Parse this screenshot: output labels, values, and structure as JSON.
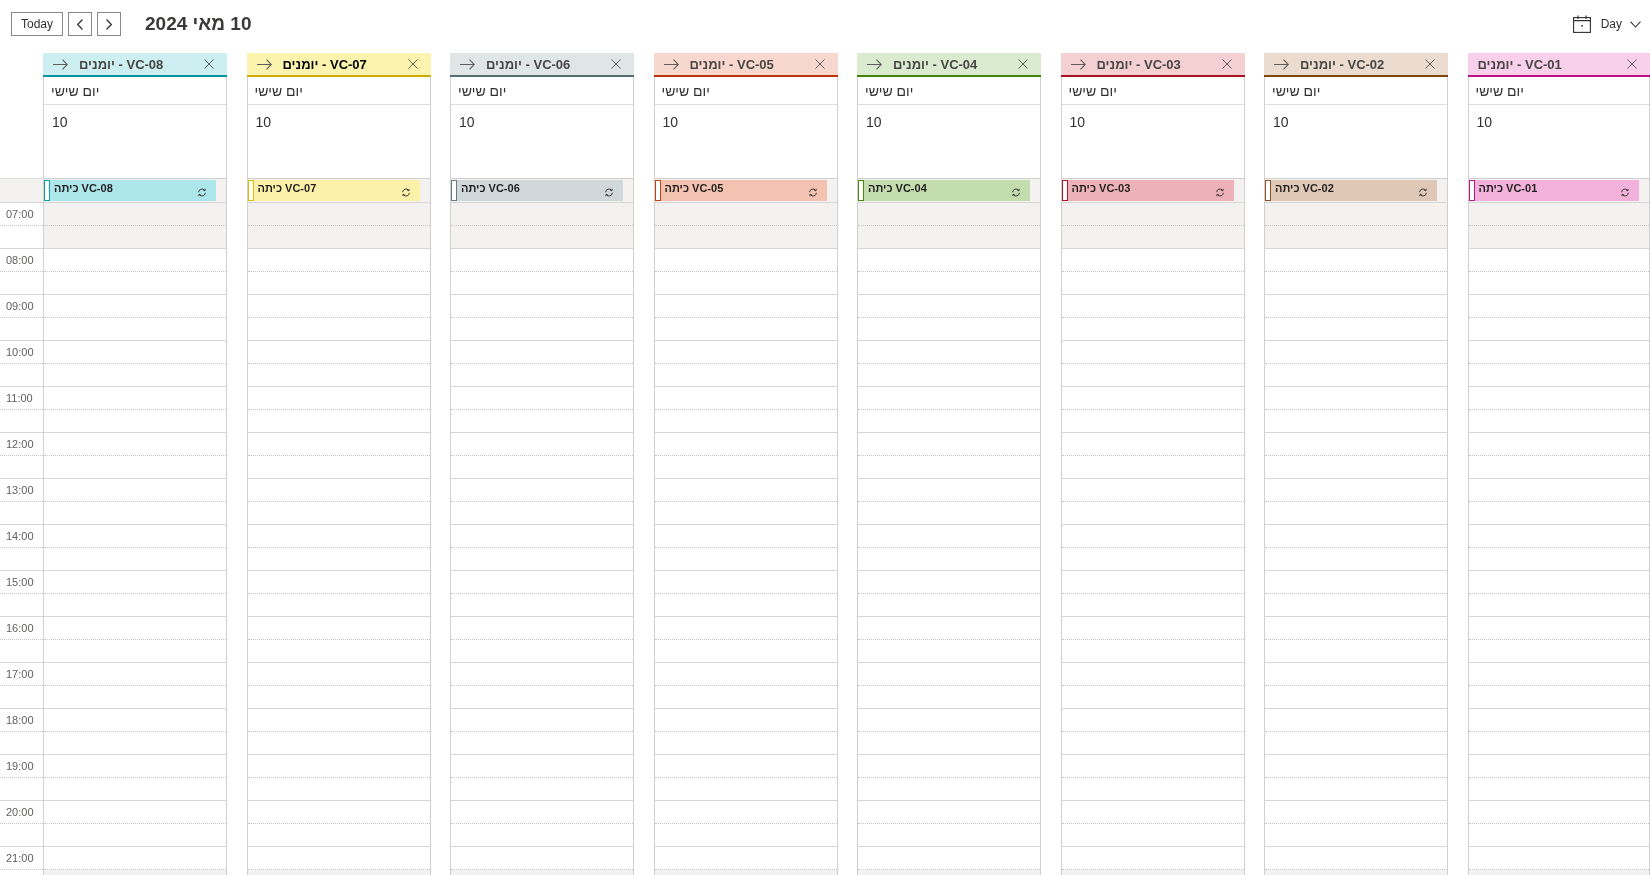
{
  "toolbar": {
    "today_button": "Today",
    "date_title": "10 מאי 2024",
    "view": "Day"
  },
  "hours": [
    {
      "label": "07:00",
      "slots": [
        {
          "off_hours": true
        },
        {
          "off_hours": true
        }
      ]
    },
    {
      "label": "08:00",
      "slots": [
        {
          "off_hours": false
        },
        {
          "off_hours": false
        }
      ]
    },
    {
      "label": "09:00",
      "slots": [
        {
          "off_hours": false
        },
        {
          "off_hours": false
        }
      ]
    },
    {
      "label": "10:00",
      "slots": [
        {
          "off_hours": false
        },
        {
          "off_hours": false
        }
      ]
    },
    {
      "label": "11:00",
      "slots": [
        {
          "off_hours": false
        },
        {
          "off_hours": false
        }
      ]
    },
    {
      "label": "12:00",
      "slots": [
        {
          "off_hours": false
        },
        {
          "off_hours": false
        }
      ]
    },
    {
      "label": "13:00",
      "slots": [
        {
          "off_hours": false
        },
        {
          "off_hours": false
        }
      ]
    },
    {
      "label": "14:00",
      "slots": [
        {
          "off_hours": false
        },
        {
          "off_hours": false
        }
      ]
    },
    {
      "label": "15:00",
      "slots": [
        {
          "off_hours": false
        },
        {
          "off_hours": false
        }
      ]
    },
    {
      "label": "16:00",
      "slots": [
        {
          "off_hours": false
        },
        {
          "off_hours": false
        }
      ]
    },
    {
      "label": "17:00",
      "slots": [
        {
          "off_hours": false
        },
        {
          "off_hours": false
        }
      ]
    },
    {
      "label": "18:00",
      "slots": [
        {
          "off_hours": false
        },
        {
          "off_hours": false
        }
      ]
    },
    {
      "label": "19:00",
      "slots": [
        {
          "off_hours": false
        },
        {
          "off_hours": false
        }
      ]
    },
    {
      "label": "20:00",
      "slots": [
        {
          "off_hours": false
        },
        {
          "off_hours": false
        }
      ]
    },
    {
      "label": "21:00",
      "slots": [
        {
          "off_hours": false
        },
        {
          "off_hours": true
        }
      ]
    }
  ],
  "calendars": [
    {
      "title": "יומנים - VC-01",
      "color": "#f8d0eb",
      "has_arrow": false,
      "day_name": "יום שישי",
      "day_number": "10",
      "all_day_events": [
        {
          "title": "כיתה VC-01",
          "color": "#f3b2dc"
        }
      ]
    },
    {
      "title": "יומנים - VC-02",
      "color": "#ebdccf",
      "has_arrow": true,
      "day_name": "יום שישי",
      "day_number": "10",
      "all_day_events": [
        {
          "title": "כיתה VC-02",
          "color": "#dfc8b6"
        }
      ]
    },
    {
      "title": "יומנים - VC-03",
      "color": "#f4d0d3",
      "has_arrow": true,
      "day_name": "יום שישי",
      "day_number": "10",
      "all_day_events": [
        {
          "title": "כיתה VC-03",
          "color": "#edb2b8"
        }
      ]
    },
    {
      "title": "יומנים - VC-04",
      "color": "#dbebcf",
      "has_arrow": true,
      "day_name": "יום שישי",
      "day_number": "10",
      "all_day_events": [
        {
          "title": "כיתה VC-04",
          "color": "#c3ddae"
        }
      ]
    },
    {
      "title": "יומנים - VC-05",
      "color": "#f8d8ce",
      "has_arrow": true,
      "day_name": "יום שישי",
      "day_number": "10",
      "all_day_events": [
        {
          "title": "כיתה VC-05",
          "color": "#f3c2b0"
        }
      ]
    },
    {
      "title": "יומנים - VC-06",
      "color": "#e0e6e6",
      "has_arrow": true,
      "day_name": "יום שישי",
      "day_number": "10",
      "all_day_events": [
        {
          "title": "כיתה VC-06",
          "color": "#d0d8db"
        }
      ]
    },
    {
      "title": "יומנים - VC-07",
      "color": "#fcf4ae",
      "has_arrow": true,
      "day_name": "יום שישי",
      "day_number": "10",
      "all_day_events": [
        {
          "title": "כיתה VC-07",
          "color": "#fbf1a8"
        }
      ]
    },
    {
      "title": "יומנים - VC-08",
      "color": "#cdeff2",
      "has_arrow": true,
      "day_name": "יום שישי",
      "day_number": "10",
      "all_day_events": [
        {
          "title": "כיתה VC-08",
          "color": "#ade6eb"
        }
      ]
    }
  ]
}
